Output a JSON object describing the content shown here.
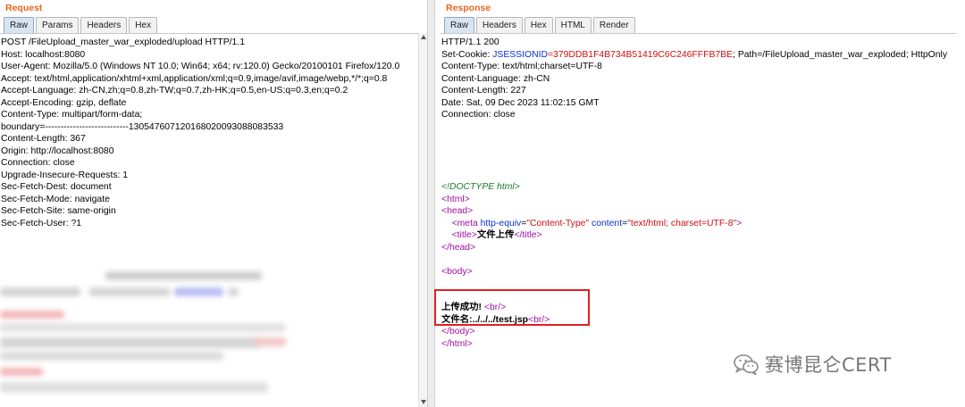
{
  "request": {
    "title": "Request",
    "tabs": [
      "Raw",
      "Params",
      "Headers",
      "Hex"
    ],
    "lines": [
      "POST /FileUpload_master_war_exploded/upload HTTP/1.1",
      "Host: localhost:8080",
      "User-Agent: Mozilla/5.0 (Windows NT 10.0; Win64; x64; rv:120.0) Gecko/20100101 Firefox/120.0",
      "Accept: text/html,application/xhtml+xml,application/xml;q=0.9,image/avif,image/webp,*/*;q=0.8",
      "Accept-Language: zh-CN,zh;q=0.8,zh-TW;q=0.7,zh-HK;q=0.5,en-US;q=0.3,en;q=0.2",
      "Accept-Encoding: gzip, deflate",
      "Content-Type: multipart/form-data;",
      "boundary=---------------------------130547607120168020093088083533",
      "Content-Length: 367",
      "Origin: http://localhost:8080",
      "Connection: close",
      "Upgrade-Insecure-Requests: 1",
      "Sec-Fetch-Dest: document",
      "Sec-Fetch-Mode: navigate",
      "Sec-Fetch-Site: same-origin",
      "Sec-Fetch-User: ?1"
    ]
  },
  "response": {
    "title": "Response",
    "tabs": [
      "Raw",
      "Headers",
      "Hex",
      "HTML",
      "Render"
    ],
    "status_line": "HTTP/1.1 200",
    "set_cookie_prefix": "Set-Cookie: ",
    "cookie_name": "JSESSIONID",
    "cookie_value": "=379DDB1F4B734B51419C6C246FFFB7BE",
    "cookie_suffix": "; Path=/FileUpload_master_war_exploded; HttpOnly",
    "headers": [
      "Content-Type: text/html;charset=UTF-8",
      "Content-Language: zh-CN",
      "Content-Length: 227",
      "Date: Sat, 09 Dec 2023 11:02:15 GMT",
      "Connection: close"
    ],
    "doctype": "<!DOCTYPE html>",
    "html_open": "<html>",
    "head_open": "<head>",
    "meta_open": "<meta ",
    "meta_attr1": "http-equiv",
    "meta_eq1": "=",
    "meta_val1": "\"Content-Type\"",
    "meta_attr2": " content",
    "meta_eq2": "=",
    "meta_val2": "\"text/html; charset=UTF-8\"",
    "meta_close": ">",
    "title_open": "<title>",
    "title_text": "文件上传",
    "title_close": "</title>",
    "head_close": "</head>",
    "body_open": "<body>",
    "success_text": "上传成功! ",
    "br": "<br/>",
    "filename_text": "文件名:../../../test.jsp",
    "body_close": "</body>",
    "html_close": "</html>"
  },
  "watermark": {
    "text": "赛博昆仑CERT",
    "icon": "wechat-icon"
  },
  "colors": {
    "title_orange": "#e8661c",
    "tag_purple": "#a00fa0",
    "attr_blue": "#0b2fd6",
    "value_red": "#d10f0f",
    "doctype_green": "#1b7a2a",
    "highlight_red": "#e02020"
  }
}
